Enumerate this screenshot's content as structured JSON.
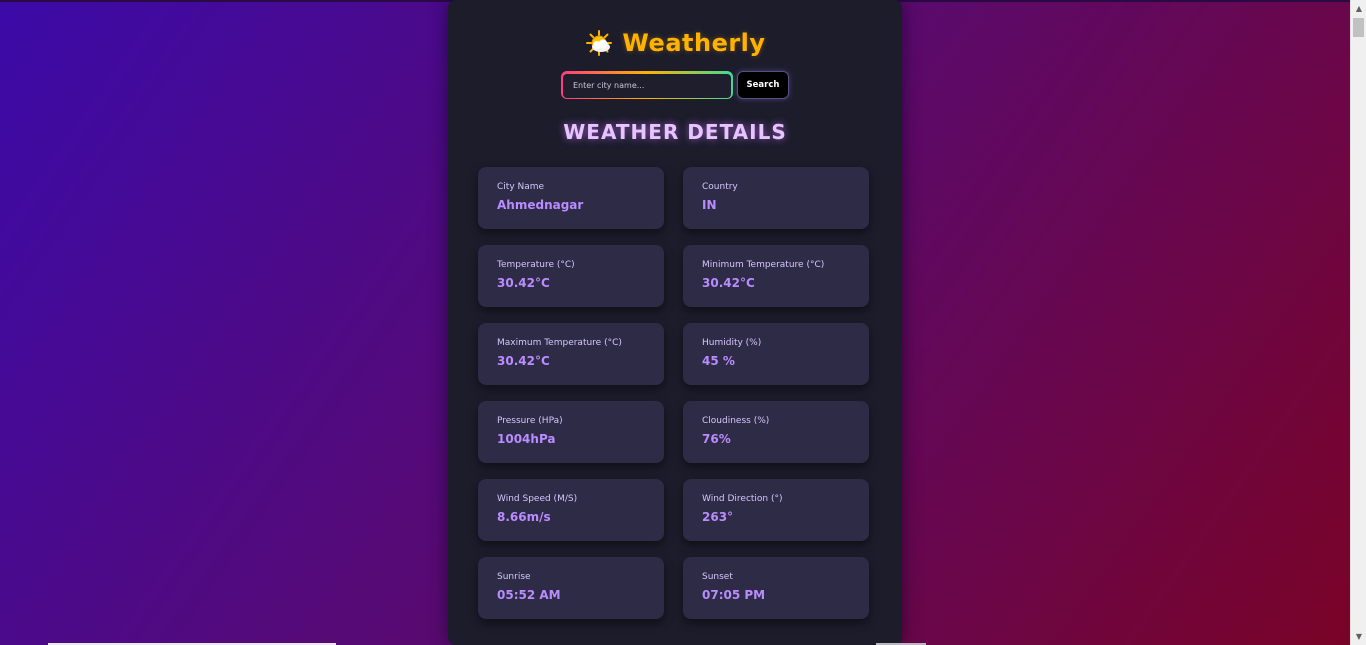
{
  "app": {
    "title": "Weatherly",
    "logo_icon": "sun-behind-cloud-icon"
  },
  "search": {
    "placeholder": "Enter city name...",
    "value": "",
    "button_label": "Search"
  },
  "section": {
    "title": "WEATHER DETAILS"
  },
  "details": [
    {
      "label": "City Name",
      "value": "Ahmednagar"
    },
    {
      "label": "Country",
      "value": "IN"
    },
    {
      "label": "Temperature (°C)",
      "value": "30.42°C"
    },
    {
      "label": "Minimum Temperature (°C)",
      "value": "30.42°C"
    },
    {
      "label": "Maximum Temperature (°C)",
      "value": "30.42°C"
    },
    {
      "label": "Humidity (%)",
      "value": "45 %"
    },
    {
      "label": "Pressure (HPa)",
      "value": "1004hPa"
    },
    {
      "label": "Cloudiness (%)",
      "value": "76%"
    },
    {
      "label": "Wind Speed (M/S)",
      "value": "8.66m/s"
    },
    {
      "label": "Wind Direction (°)",
      "value": "263°"
    },
    {
      "label": "Sunrise",
      "value": "05:52 AM"
    },
    {
      "label": "Sunset",
      "value": "07:05 PM"
    }
  ],
  "colors": {
    "title": "#ffb300",
    "section_title": "#e8c4ff",
    "card_bg": "#2d2b45",
    "card_value": "#b98cff",
    "panel_bg": "#1c1c2b"
  }
}
